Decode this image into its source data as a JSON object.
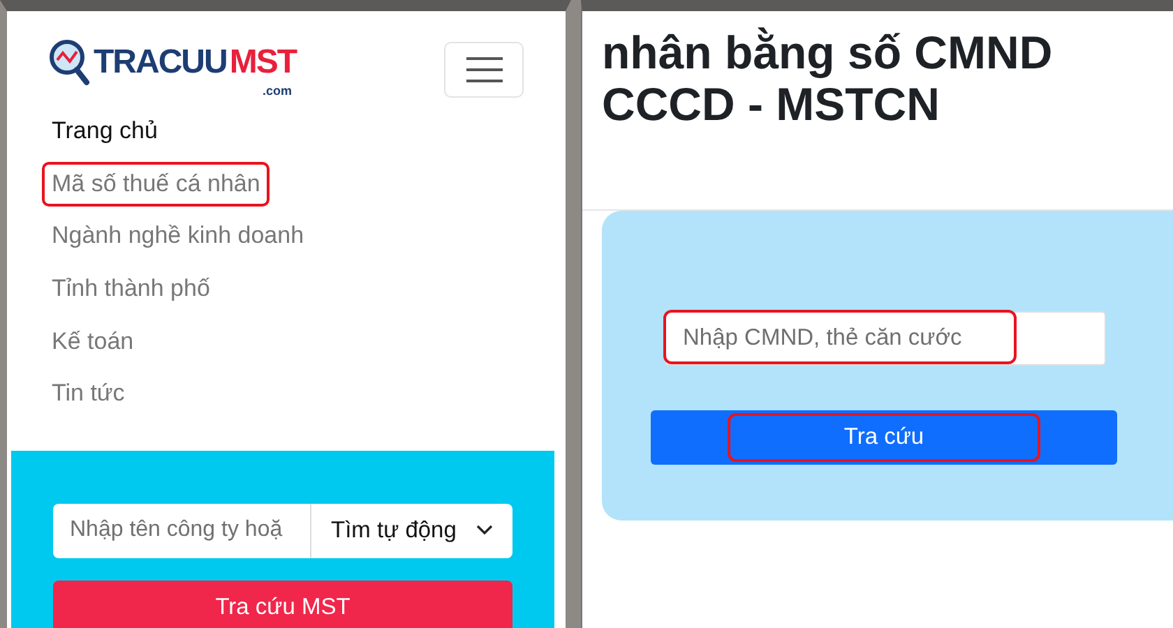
{
  "left_screen": {
    "logo": {
      "name_part_1": "TRACUU",
      "name_part_2": "MST",
      "domain": ".com"
    },
    "nav_items": [
      {
        "label": "Trang chủ",
        "selected": true,
        "highlighted": false
      },
      {
        "label": "Mã số thuế cá nhân",
        "selected": false,
        "highlighted": true
      },
      {
        "label": "Ngành nghề kinh doanh",
        "selected": false,
        "highlighted": false
      },
      {
        "label": "Tỉnh thành phố",
        "selected": false,
        "highlighted": false
      },
      {
        "label": "Kế toán",
        "selected": false,
        "highlighted": false
      },
      {
        "label": "Tin tức",
        "selected": false,
        "highlighted": false
      }
    ],
    "search": {
      "placeholder": "Nhập tên công ty hoặ",
      "mode": "Tìm tự động",
      "button": "Tra cứu MST"
    }
  },
  "right_screen": {
    "heading": "nhân bằng số CMND CCCD - MSTCN",
    "search": {
      "placeholder": "Nhập CMND, thẻ căn cước",
      "placeholder_highlighted": true,
      "button": "Tra cứu",
      "button_highlighted": true
    }
  }
}
